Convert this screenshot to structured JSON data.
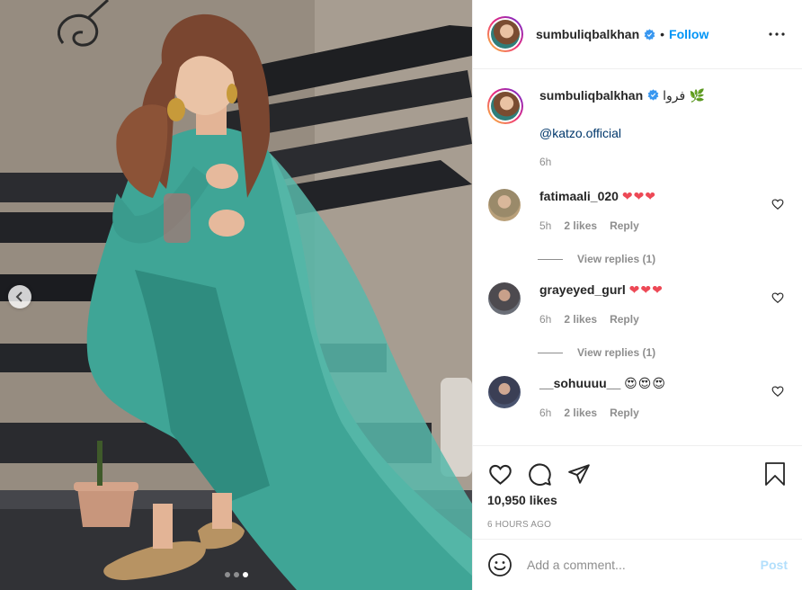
{
  "post": {
    "username": "sumbuliqbalkhan",
    "follow_label": "Follow",
    "separator": "•",
    "caption_text": "فروا 🌿",
    "mention": "@katzo.official",
    "caption_time": "6h",
    "likes": "10,950 likes",
    "posted_ago": "6 HOURS AGO",
    "carousel": {
      "count": 3,
      "active_index": 2
    }
  },
  "comments": [
    {
      "username": "fatimaali_020",
      "text": "❤❤❤",
      "time": "5h",
      "likes": "2 likes",
      "reply_label": "Reply",
      "view_replies": "View replies (1)",
      "avatar_color": "#b9a07a"
    },
    {
      "username": "grayeyed_gurl",
      "text": "❤❤❤",
      "time": "6h",
      "likes": "2 likes",
      "reply_label": "Reply",
      "view_replies": "View replies (1)",
      "avatar_color": "#6b6f78"
    },
    {
      "username": "__sohuuuu__",
      "text": "😍😍😍",
      "time": "6h",
      "likes": "2 likes",
      "reply_label": "Reply",
      "avatar_color": "#4a5470"
    }
  ],
  "composer": {
    "placeholder": "Add a comment...",
    "post_label": "Post"
  },
  "colors": {
    "accent": "#0095f6",
    "heart_red": "#ed4956",
    "muted": "#8e8e8e",
    "post_disabled": "#b2dffc"
  },
  "icons": [
    "chevron-left-icon",
    "more-options-icon",
    "verified-badge-icon",
    "heart-icon",
    "comment-icon",
    "share-icon",
    "bookmark-icon",
    "emoji-icon"
  ]
}
